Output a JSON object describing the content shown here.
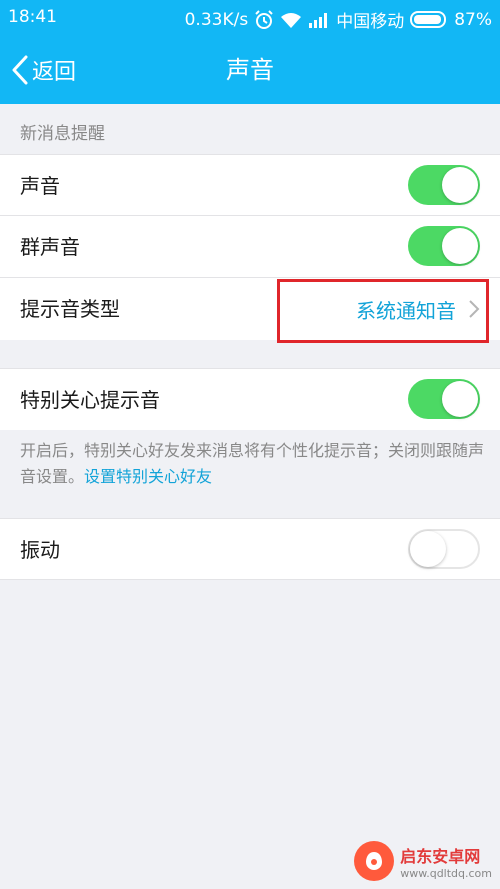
{
  "status_bar": {
    "time": "18:41",
    "speed": "0.33K/s",
    "carrier": "中国移动",
    "battery": "87%"
  },
  "nav": {
    "back_label": "返回",
    "title": "声音"
  },
  "section": {
    "header": "新消息提醒"
  },
  "rows": {
    "sound": {
      "label": "声音",
      "on": true
    },
    "group_sound": {
      "label": "群声音",
      "on": true
    },
    "tone_type": {
      "label": "提示音类型",
      "value": "系统通知音"
    },
    "special_care": {
      "label": "特别关心提示音",
      "on": true
    },
    "vibrate": {
      "label": "振动",
      "on": false
    }
  },
  "note": {
    "text": "开启后，特别关心好友发来消息将有个性化提示音；关闭则跟随声音设置。",
    "link": "设置特别关心好友"
  },
  "watermark": {
    "name": "启东安卓网",
    "url": "www.qdltdq.com"
  },
  "colors": {
    "brand": "#12b7f5",
    "toggle_on": "#4cd964",
    "link": "#12a3d8",
    "highlight": "#e0262b"
  }
}
